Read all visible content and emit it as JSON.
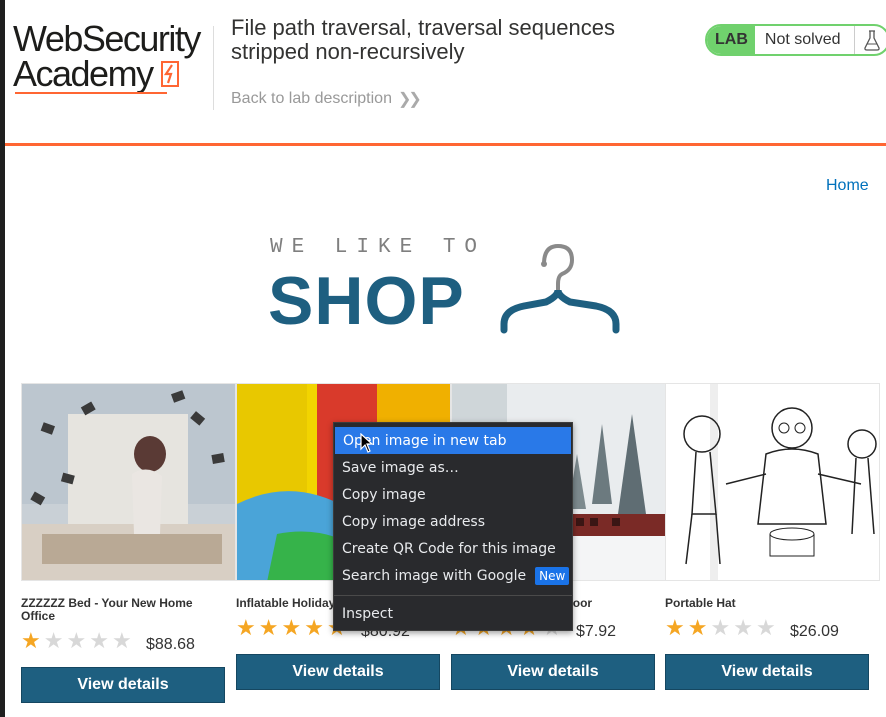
{
  "header": {
    "logo_line1": "WebSecurity",
    "logo_line2": "Academy",
    "lab_title": "File path traversal, traversal sequences stripped non-recursively",
    "back_link": "Back to lab description",
    "status_tag": "LAB",
    "status_text": "Not solved",
    "accent_color": "#ff6633",
    "solved_color": "#70d16d"
  },
  "nav": {
    "home": "Home"
  },
  "shop_logo": {
    "tagline": "WE LIKE TO",
    "word": "SHOP"
  },
  "products": [
    {
      "name": "ZZZZZZ Bed - Your New Home Office",
      "rating": 1,
      "price": "$88.68",
      "button": "View details"
    },
    {
      "name": "Inflatable Holiday Home",
      "rating": 5,
      "price": "$80.92",
      "button": "View details"
    },
    {
      "name": "Hitch A Lift To Your Door",
      "rating": 4,
      "price": "$7.92",
      "button": "View details"
    },
    {
      "name": "Portable Hat",
      "rating": 2,
      "price": "$26.09",
      "button": "View details"
    }
  ],
  "context_menu": {
    "items": [
      "Open image in new tab",
      "Save image as…",
      "Copy image",
      "Copy image address",
      "Create QR Code for this image",
      "Search image with Google"
    ],
    "badge": "New",
    "inspect": "Inspect"
  },
  "colors": {
    "brand_blue": "#1e5f80",
    "link": "#0071bc",
    "star": "#f5a623"
  }
}
